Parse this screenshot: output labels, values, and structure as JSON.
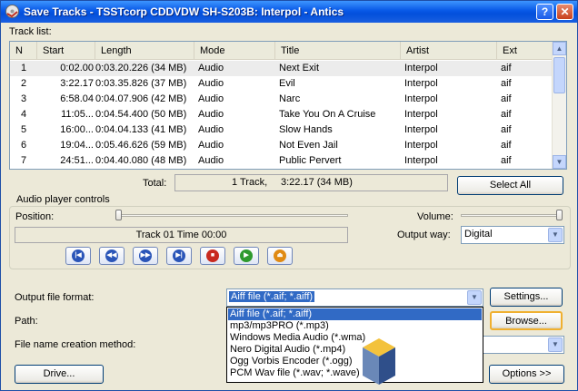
{
  "window": {
    "title": "Save Tracks - TSSTcorp CDDVDW SH-S203B:  Interpol - Antics"
  },
  "titlebar_buttons": {
    "help": "?",
    "close": "✕"
  },
  "tracklist": {
    "label": "Track list:",
    "columns": [
      "N",
      "Start",
      "Length",
      "Mode",
      "Title",
      "Artist",
      "Ext"
    ],
    "rows": [
      {
        "n": "1",
        "start": "0:02.00",
        "length": "0:03.20.226 (34 MB)",
        "mode": "Audio",
        "title": "Next Exit",
        "artist": "Interpol",
        "ext": "aif"
      },
      {
        "n": "2",
        "start": "3:22.17",
        "length": "0:03.35.826 (37 MB)",
        "mode": "Audio",
        "title": "Evil",
        "artist": "Interpol",
        "ext": "aif"
      },
      {
        "n": "3",
        "start": "6:58.04",
        "length": "0:04.07.906 (42 MB)",
        "mode": "Audio",
        "title": "Narc",
        "artist": "Interpol",
        "ext": "aif"
      },
      {
        "n": "4",
        "start": "11:05...",
        "length": "0:04.54.400 (50 MB)",
        "mode": "Audio",
        "title": "Take You On A Cruise",
        "artist": "Interpol",
        "ext": "aif"
      },
      {
        "n": "5",
        "start": "16:00...",
        "length": "0:04.04.133 (41 MB)",
        "mode": "Audio",
        "title": "Slow Hands",
        "artist": "Interpol",
        "ext": "aif"
      },
      {
        "n": "6",
        "start": "19:04...",
        "length": "0:05.46.626 (59 MB)",
        "mode": "Audio",
        "title": "Not Even Jail",
        "artist": "Interpol",
        "ext": "aif"
      },
      {
        "n": "7",
        "start": "24:51...",
        "length": "0:04.40.080 (48 MB)",
        "mode": "Audio",
        "title": "Public Pervert",
        "artist": "Interpol",
        "ext": "aif"
      }
    ],
    "total_label": "Total:",
    "total_tracks": "1 Track,",
    "total_time": "3:22.17 (34 MB)",
    "select_all": "Select All"
  },
  "player": {
    "group_label": "Audio player controls",
    "position_label": "Position:",
    "status": "Track 01 Time 00:00",
    "volume_label": "Volume:",
    "output_way_label": "Output way:",
    "output_way_value": "Digital",
    "position_fraction": 0.0,
    "volume_fraction": 1.0,
    "controls": [
      {
        "name": "first-track-icon",
        "glyph": "|◀",
        "color": "#2a55b8"
      },
      {
        "name": "rewind-icon",
        "glyph": "◀◀",
        "color": "#2a55b8"
      },
      {
        "name": "fast-forward-icon",
        "glyph": "▶▶",
        "color": "#2a55b8"
      },
      {
        "name": "last-track-icon",
        "glyph": "▶|",
        "color": "#2a55b8"
      },
      {
        "name": "stop-icon",
        "glyph": "■",
        "color": "#c8291e"
      },
      {
        "name": "play-icon",
        "glyph": "▶",
        "color": "#2e9a2e"
      },
      {
        "name": "eject-icon",
        "glyph": "⏏",
        "color": "#e08a14"
      }
    ]
  },
  "output": {
    "format_label": "Output file format:",
    "format_value": "Aiff file (*.aif; *.aiff)",
    "settings_button": "Settings...",
    "path_label": "Path:",
    "browse_button": "Browse...",
    "naming_label": "File name creation method:",
    "format_options": [
      "Aiff file (*.aif; *.aiff)",
      "mp3/mp3PRO (*.mp3)",
      "Windows Media Audio (*.wma)",
      "Nero Digital Audio (*.mp4)",
      "Ogg Vorbis Encoder (*.ogg)",
      "PCM Wav file (*.wav; *.wave)"
    ]
  },
  "footer": {
    "drive_button": "Drive...",
    "options_button": "Options >>"
  },
  "colors": {
    "titlebar": "#0858e6",
    "selection": "#316ac5",
    "window_bg": "#ece9d8"
  }
}
